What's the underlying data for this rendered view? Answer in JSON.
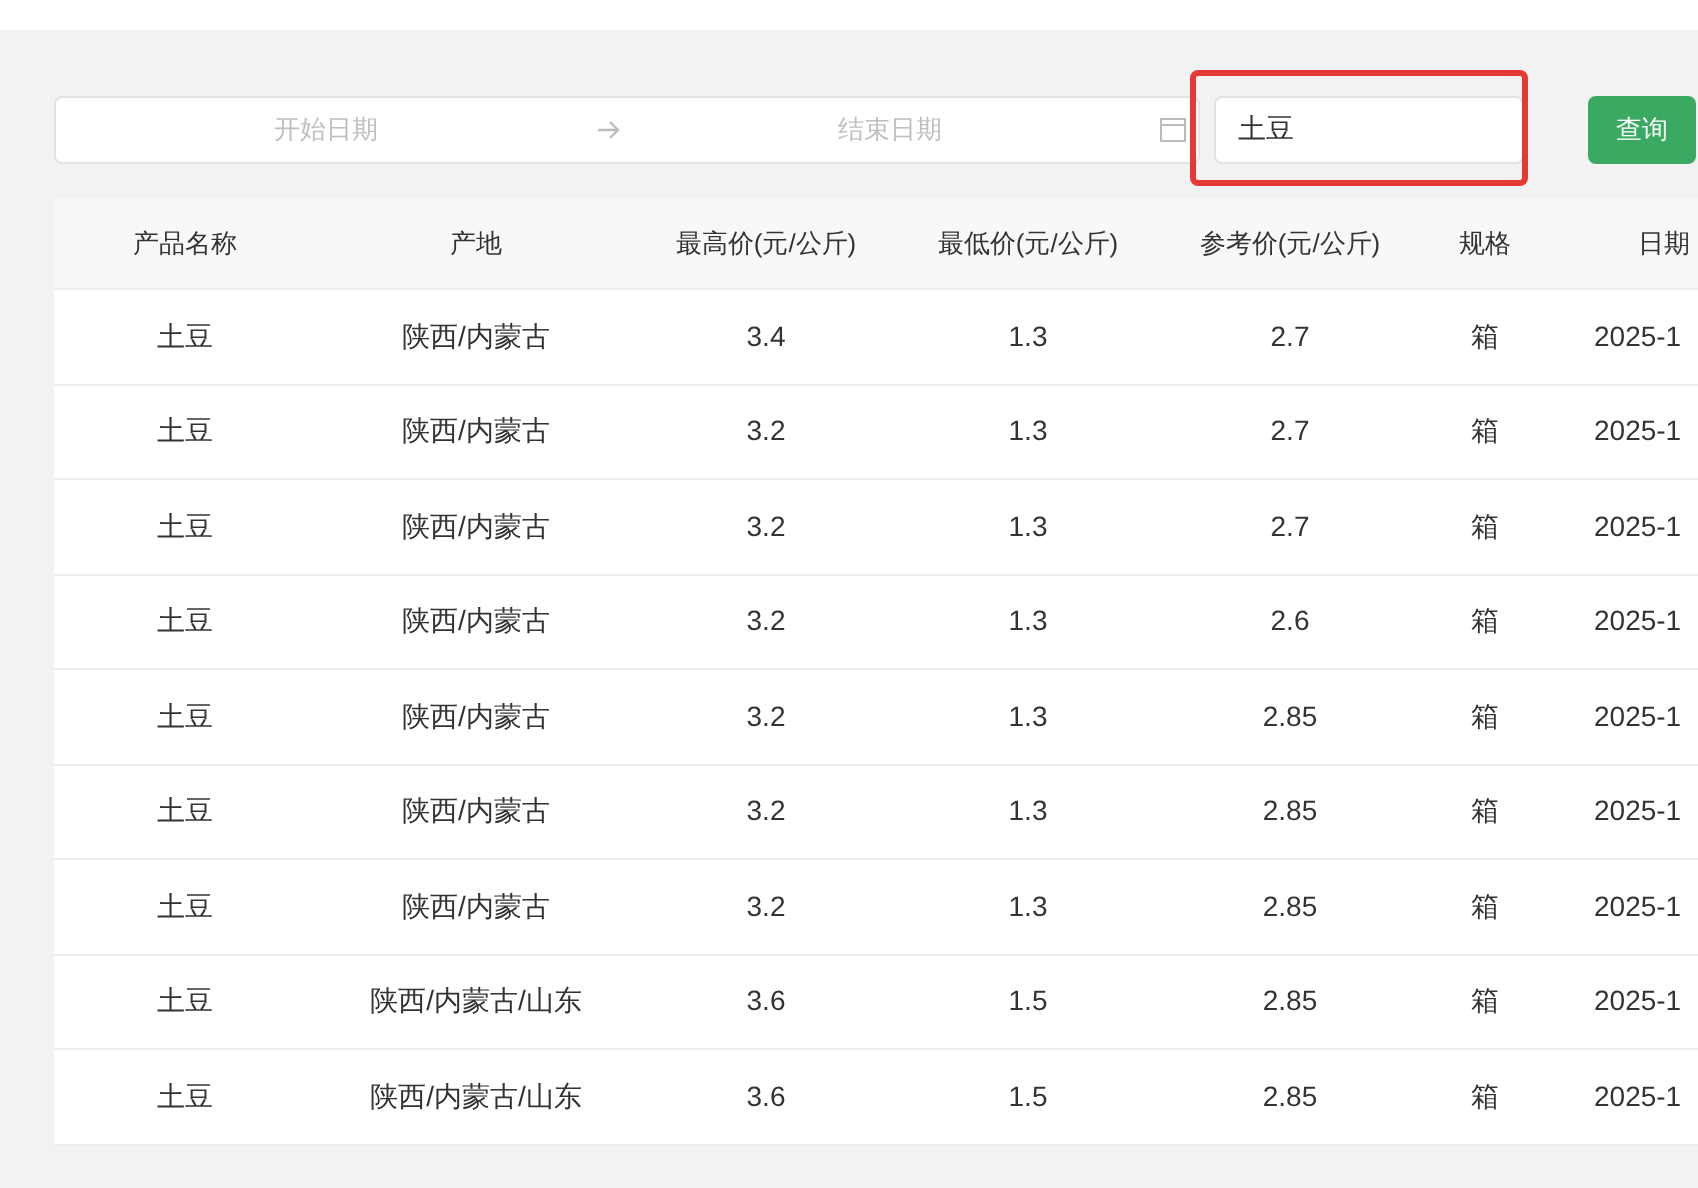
{
  "filters": {
    "start_date": {
      "placeholder": "开始日期"
    },
    "end_date": {
      "placeholder": "结束日期"
    },
    "search": {
      "value": "土豆",
      "highlighted": true
    },
    "query_button": "查询"
  },
  "table": {
    "columns": [
      "产品名称",
      "产地",
      "最高价(元/公斤)",
      "最低价(元/公斤)",
      "参考价(元/公斤)",
      "规格",
      "日期"
    ],
    "rows": [
      [
        "土豆",
        "陕西/内蒙古",
        "3.4",
        "1.3",
        "2.7",
        "箱",
        "2025-1"
      ],
      [
        "土豆",
        "陕西/内蒙古",
        "3.2",
        "1.3",
        "2.7",
        "箱",
        "2025-1"
      ],
      [
        "土豆",
        "陕西/内蒙古",
        "3.2",
        "1.3",
        "2.7",
        "箱",
        "2025-1"
      ],
      [
        "土豆",
        "陕西/内蒙古",
        "3.2",
        "1.3",
        "2.6",
        "箱",
        "2025-1"
      ],
      [
        "土豆",
        "陕西/内蒙古",
        "3.2",
        "1.3",
        "2.85",
        "箱",
        "2025-1"
      ],
      [
        "土豆",
        "陕西/内蒙古",
        "3.2",
        "1.3",
        "2.85",
        "箱",
        "2025-1"
      ],
      [
        "土豆",
        "陕西/内蒙古",
        "3.2",
        "1.3",
        "2.85",
        "箱",
        "2025-1"
      ],
      [
        "土豆",
        "陕西/内蒙古/山东",
        "3.6",
        "1.5",
        "2.85",
        "箱",
        "2025-1"
      ],
      [
        "土豆",
        "陕西/内蒙古/山东",
        "3.6",
        "1.5",
        "2.85",
        "箱",
        "2025-1"
      ]
    ]
  }
}
